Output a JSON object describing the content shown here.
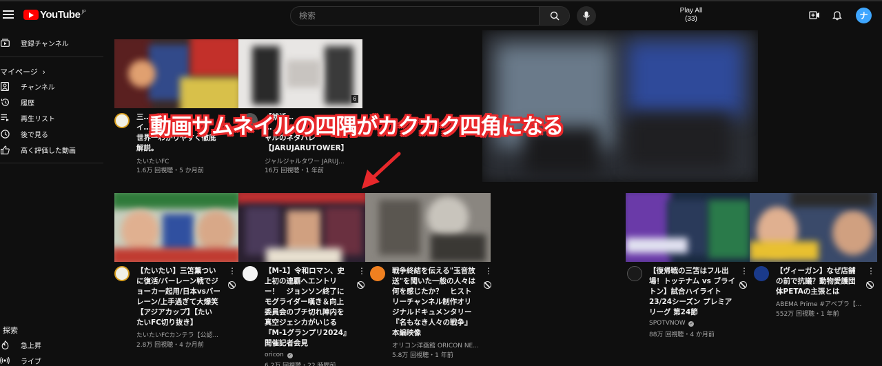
{
  "header": {
    "logo_text": "YouTube",
    "logo_region": "JP",
    "search_placeholder": "検索",
    "play_all_label": "Play All",
    "play_all_count": "(33)",
    "avatar_letter": "ナ"
  },
  "sidebar": {
    "subscriptions": "登録チャンネル",
    "my_page": "マイページ",
    "items": [
      "チャンネル",
      "履歴",
      "再生リスト",
      "後で見る",
      "高く評価した動画"
    ],
    "explore": "探索",
    "explore_items": [
      "急上昇",
      "ライブ"
    ]
  },
  "annotation": "動画サムネイルの四隅がカクカク四角になる",
  "row1": [
    {
      "title_lines": [
        "三…",
        "イ…",
        "世界一わかりやすく徹底",
        "解説。"
      ],
      "channel": "たいたいFC",
      "stats": "1.6万 回視聴・5 か月前",
      "badge": "6"
    },
    {
      "title_lines": [
        "【就活…",
        "…",
        "ャルのネタバレ",
        "【JARUJARUTOWER】"
      ],
      "channel": "ジャルジャルタワー JARUJ...",
      "stats": "16万 回視聴・1 年前"
    }
  ],
  "row2": [
    {
      "title_lines": [
        "【たいたい】三笘薫つい",
        "に復活/バーレーン戦でジ",
        "ョーカー起用/日本vsバー",
        "レーン/上手過ぎて大爆笑",
        "【アジアカップ】【たい",
        "たいFC切り抜き】"
      ],
      "channel": "たいたいFCカンテラ【公認...",
      "stats": "2.8万 回視聴・4 か月前"
    },
    {
      "title_lines": [
        "【M-1】令和ロマン、史",
        "上初の連覇へエントリ",
        "ー！　ジョンソン終了に",
        "モグライダー嘆き＆向上",
        "委員会のブチ切れ陣内を",
        "真空ジェシカがいじる",
        "『M-1グランプリ2024』",
        "開催記者会見"
      ],
      "channel": "oricon",
      "stats": "6.2万 回視聴・22 時間前"
    },
    {
      "title_lines": [
        "戦争終結を伝える\"玉音放",
        "送\"を聞いた一般の人々は",
        "何を感じたか？　ヒスト",
        "リーチャンネル制作オリ",
        "ジナルドキュメンタリー",
        "『名もなき人々の戦争』",
        "本編映像"
      ],
      "channel": "オリコン洋画館 ORICON NE...",
      "stats": "5.8万 回視聴・1 年前"
    },
    {
      "title_lines": [
        "【復帰戦の三笘はフル出",
        "場！トッテナム vs ブライ",
        "トン】試合ハイライト",
        "23/24シーズン プレミア",
        "リーグ 第24節"
      ],
      "channel": "SPOTVNOW",
      "stats": "88万 回視聴・4 か月前"
    },
    {
      "title_lines": [
        "【ヴィーガン】なぜ店舗",
        "の前で抗議？動物愛護団",
        "体PETAの主張とは"
      ],
      "channel": "ABEMA Prime #アベプラ【...",
      "stats": "552万 回視聴・1 年前"
    }
  ],
  "colors": {
    "background": "#0f0f0f",
    "annotation_fill": "#ffffff",
    "annotation_outline": "#e8282b",
    "arrow": "#e8282b"
  }
}
